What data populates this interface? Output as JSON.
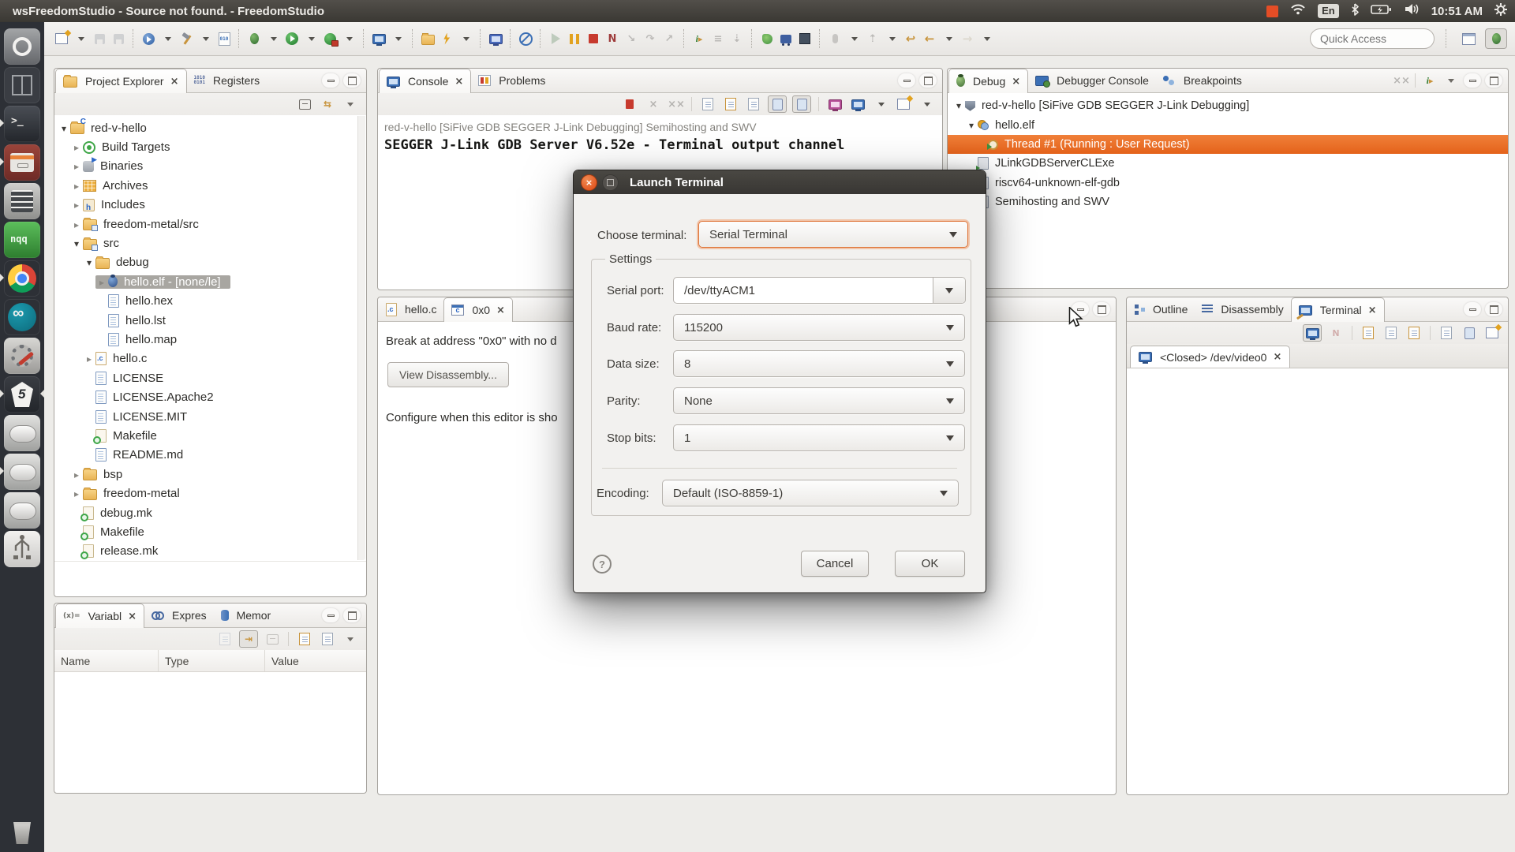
{
  "topbar": {
    "title": "wsFreedomStudio - Source not found. - FreedomStudio",
    "keyboard_indicator": "En",
    "clock": "10:51 AM"
  },
  "launcher": {
    "items": [
      "ubuntu-dash",
      "workspace-switcher",
      "terminal",
      "file-manager",
      "calculator",
      "notepadqq",
      "chrome",
      "arduino",
      "system-tweaks",
      "freedomstudio",
      "disk-drive-1",
      "disk-drive-2",
      "disk-drive-3",
      "usb-drive",
      "trash"
    ]
  },
  "toolbar": {
    "quick_access_placeholder": "Quick Access",
    "icons": [
      "new-wizard",
      "save",
      "save-all",
      "upload-flash",
      "build",
      "binary-utilities",
      "debug",
      "run",
      "external-tools",
      "console-view",
      "open-folder",
      "connect",
      "console",
      "skip-all-breakpoints",
      "resume",
      "suspend",
      "terminate",
      "disconnect",
      "step-into",
      "step-over",
      "step-return",
      "instruction-stepping",
      "show-threads",
      "restart",
      "profile",
      "memory",
      "chip",
      "record",
      "expand",
      "back",
      "forward",
      "open-perspective",
      "debug-perspective"
    ]
  },
  "project_explorer": {
    "tab_explorer": "Project Explorer",
    "tab_registers": "Registers",
    "tree": [
      "red-v-hello",
      "Build Targets",
      "Binaries",
      "Archives",
      "Includes",
      "freedom-metal/src",
      "src",
      "debug",
      "hello.elf - [none/le]",
      "hello.hex",
      "hello.lst",
      "hello.map",
      "hello.c",
      "LICENSE",
      "LICENSE.Apache2",
      "LICENSE.MIT",
      "Makefile",
      "README.md",
      "bsp",
      "freedom-metal",
      "debug.mk",
      "Makefile",
      "release.mk"
    ]
  },
  "variables_panel": {
    "tab_variables": "Variabl",
    "tab_expressions": "Expres",
    "tab_memory": "Memor",
    "columns": [
      "Name",
      "Type",
      "Value"
    ]
  },
  "console_panel": {
    "tab_console": "Console",
    "tab_problems": "Problems",
    "header_line": "red-v-hello [SiFive GDB SEGGER J-Link Debugging] Semihosting and SWV",
    "output_line": "SEGGER J-Link GDB Server V6.52e - Terminal output channel"
  },
  "editor": {
    "tab_hello_c": "hello.c",
    "tab_0x0": "0x0",
    "break_message": "Break at address \"0x0\" with no d",
    "view_disassembly_button": "View Disassembly...",
    "configure_message": "Configure when this editor is sho"
  },
  "debug_panel": {
    "tab_debug": "Debug",
    "tab_debugger_console": "Debugger Console",
    "tab_breakpoints": "Breakpoints",
    "tree": [
      "red-v-hello [SiFive GDB SEGGER J-Link Debugging]",
      "hello.elf",
      "Thread #1 (Running : User Request)",
      "JLinkGDBServerCLExe",
      "riscv64-unknown-elf-gdb",
      "Semihosting and SWV"
    ]
  },
  "terminal_panel": {
    "tab_outline": "Outline",
    "tab_disassembly": "Disassembly",
    "tab_terminal": "Terminal",
    "connection_tab": "<Closed> /dev/video0"
  },
  "dialog": {
    "title": "Launch Terminal",
    "choose_terminal_label": "Choose terminal:",
    "choose_terminal_value": "Serial Terminal",
    "settings_legend": "Settings",
    "fields": [
      {
        "label": "Serial port:",
        "value": "/dev/ttyACM1"
      },
      {
        "label": "Baud rate:",
        "value": "115200"
      },
      {
        "label": "Data size:",
        "value": "8"
      },
      {
        "label": "Parity:",
        "value": "None"
      },
      {
        "label": "Stop bits:",
        "value": "1"
      }
    ],
    "encoding_label": "Encoding:",
    "encoding_value": "Default (ISO-8859-1)",
    "help_glyph": "?",
    "cancel_label": "Cancel",
    "ok_label": "OK"
  }
}
